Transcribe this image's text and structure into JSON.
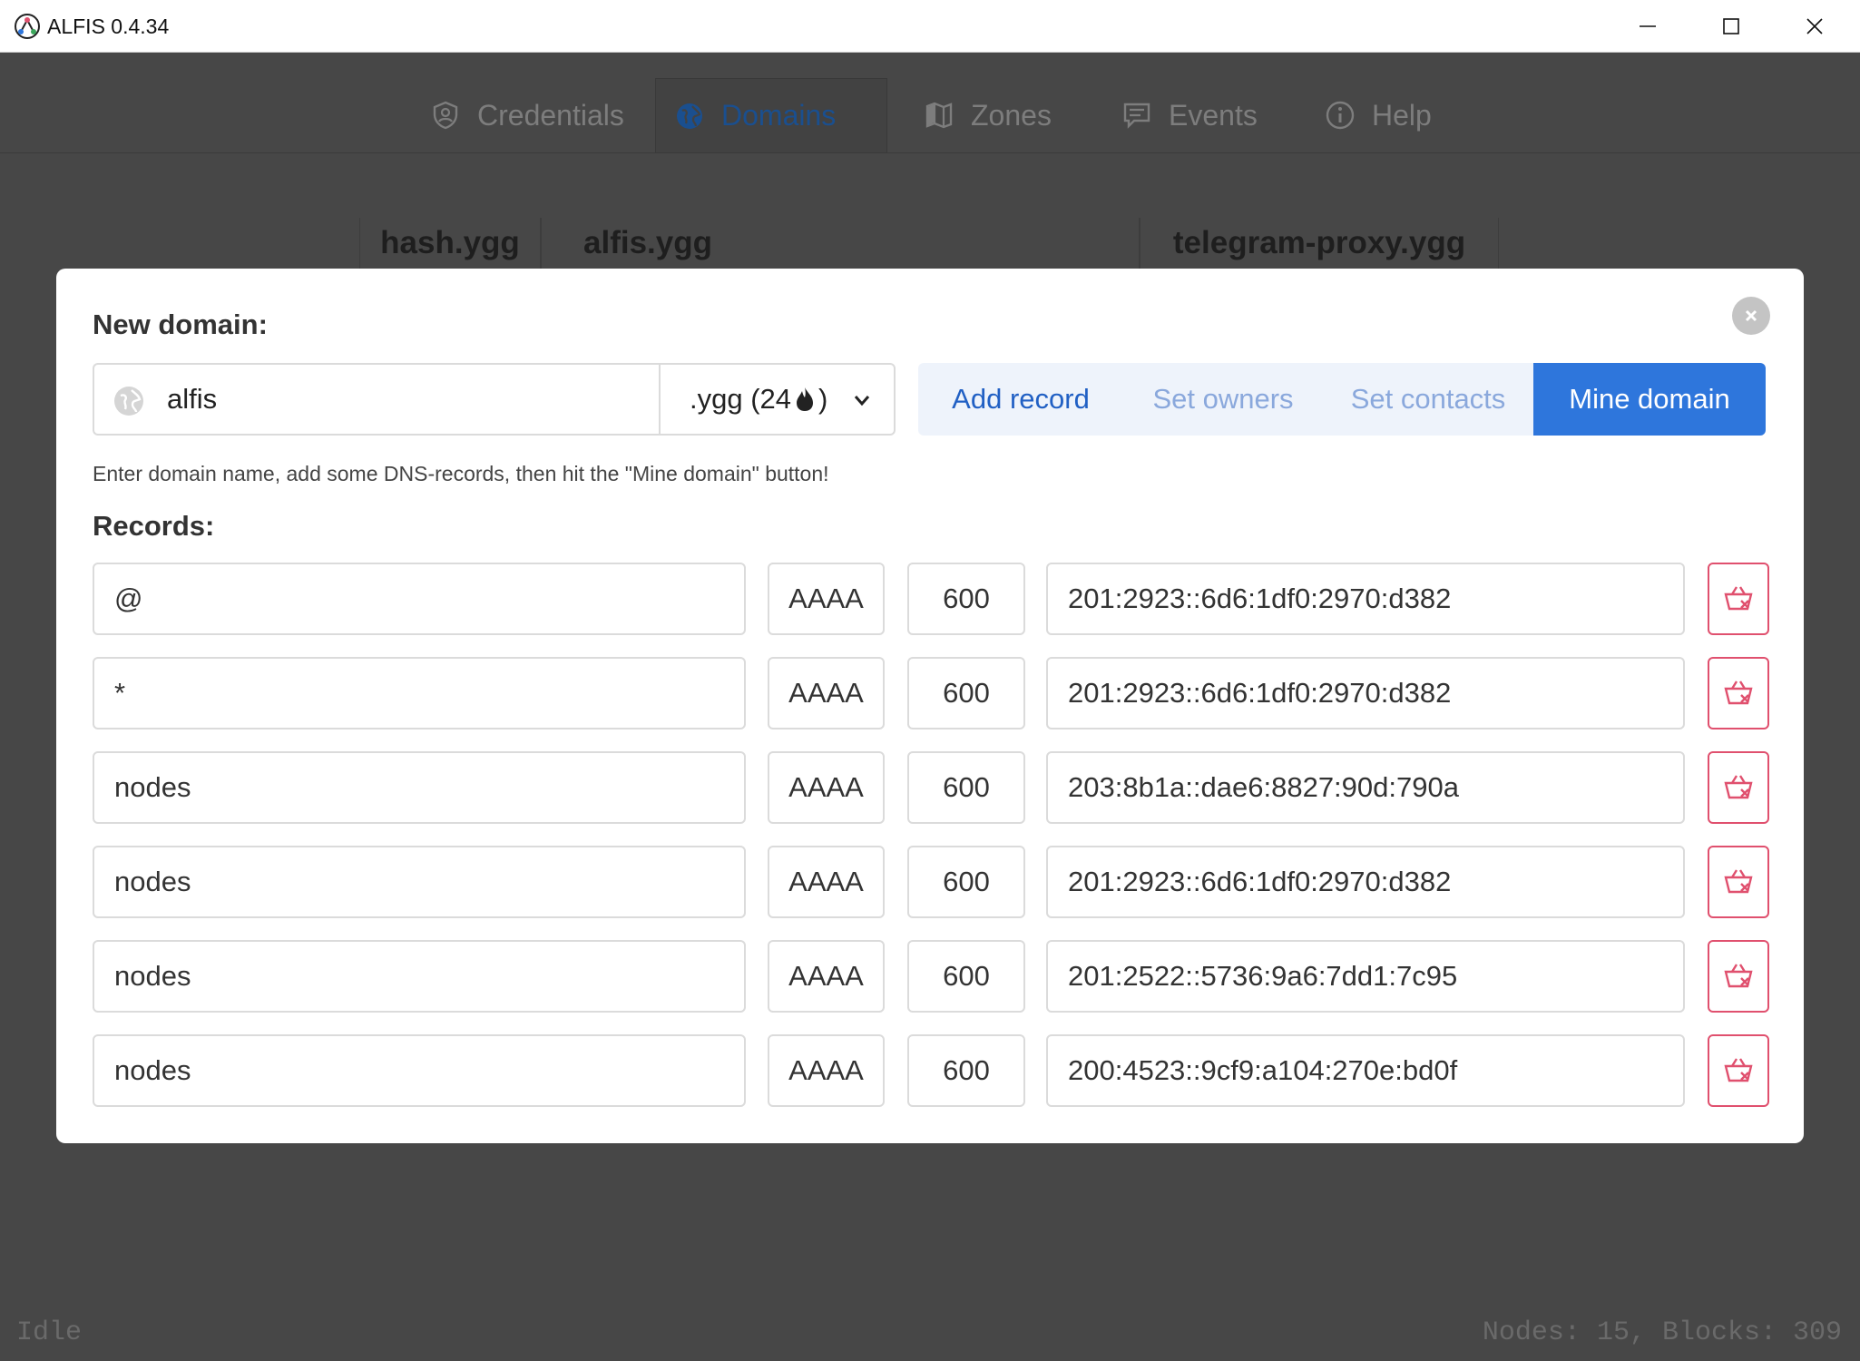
{
  "window": {
    "title": "ALFIS 0.4.34"
  },
  "tabs": [
    {
      "label": "Credentials",
      "icon": "shield-icon",
      "active": false
    },
    {
      "label": "Domains",
      "icon": "globe-icon",
      "active": true
    },
    {
      "label": "Zones",
      "icon": "map-icon",
      "active": false
    },
    {
      "label": "Events",
      "icon": "message-icon",
      "active": false
    },
    {
      "label": "Help",
      "icon": "info-icon",
      "active": false
    }
  ],
  "domain_tabs": [
    "hash.ygg",
    "alfis.ygg",
    "telegram-proxy.ygg"
  ],
  "status": {
    "left": "Idle",
    "right": "Nodes: 15, Blocks: 309"
  },
  "modal": {
    "title": "New domain:",
    "domain_value": "alfis",
    "zone_prefix": ".ygg (24",
    "zone_suffix": ")",
    "buttons": {
      "add_record": "Add record",
      "set_owners": "Set owners",
      "set_contacts": "Set contacts",
      "mine_domain": "Mine domain"
    },
    "help_text": "Enter domain name, add some DNS-records, then hit the \"Mine domain\" button!",
    "records_label": "Records:",
    "records": [
      {
        "name": "@",
        "type": "AAAA",
        "ttl": "600",
        "data": "201:2923::6d6:1df0:2970:d382"
      },
      {
        "name": "*",
        "type": "AAAA",
        "ttl": "600",
        "data": "201:2923::6d6:1df0:2970:d382"
      },
      {
        "name": "nodes",
        "type": "AAAA",
        "ttl": "600",
        "data": "203:8b1a::dae6:8827:90d:790a"
      },
      {
        "name": "nodes",
        "type": "AAAA",
        "ttl": "600",
        "data": "201:2923::6d6:1df0:2970:d382"
      },
      {
        "name": "nodes",
        "type": "AAAA",
        "ttl": "600",
        "data": "201:2522::5736:9a6:7dd1:7c95"
      },
      {
        "name": "nodes",
        "type": "AAAA",
        "ttl": "600",
        "data": "200:4523::9cf9:a104:270e:bd0f"
      }
    ]
  },
  "colors": {
    "accent": "#2e76dc",
    "danger": "#e0506e",
    "overlay": "#474747"
  }
}
